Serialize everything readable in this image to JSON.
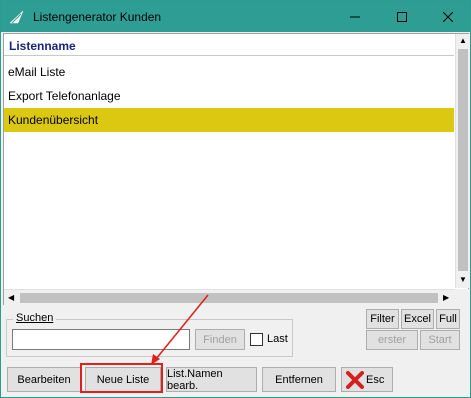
{
  "window": {
    "title": "Listengenerator Kunden",
    "minimize_glyph": "—",
    "maximize_glyph": "☐",
    "close_glyph": "✕"
  },
  "list": {
    "column_header": "Listenname",
    "items": [
      {
        "label": "eMail Liste",
        "selected": false
      },
      {
        "label": "Export Telefonanlage",
        "selected": false
      },
      {
        "label": "Kundenübersicht",
        "selected": true
      }
    ]
  },
  "search": {
    "group_label": "Suchen",
    "input_value": "",
    "find_label": "Finden",
    "last_label": "Last",
    "last_checked": false
  },
  "right_buttons": {
    "filter": "Filter",
    "excel": "Excel",
    "full": "Full",
    "erster": "erster",
    "start": "Start"
  },
  "bottom_buttons": {
    "bearbeiten": "Bearbeiten",
    "neue_liste": "Neue Liste",
    "list_namen": "List.Namen bearb.",
    "entfernen": "Entfernen",
    "esc": "Esc"
  },
  "colors": {
    "titlebar": "#2e9e95",
    "selected_row": "#dcc810",
    "header_text": "#1a237e",
    "annotation": "#e0201d"
  }
}
